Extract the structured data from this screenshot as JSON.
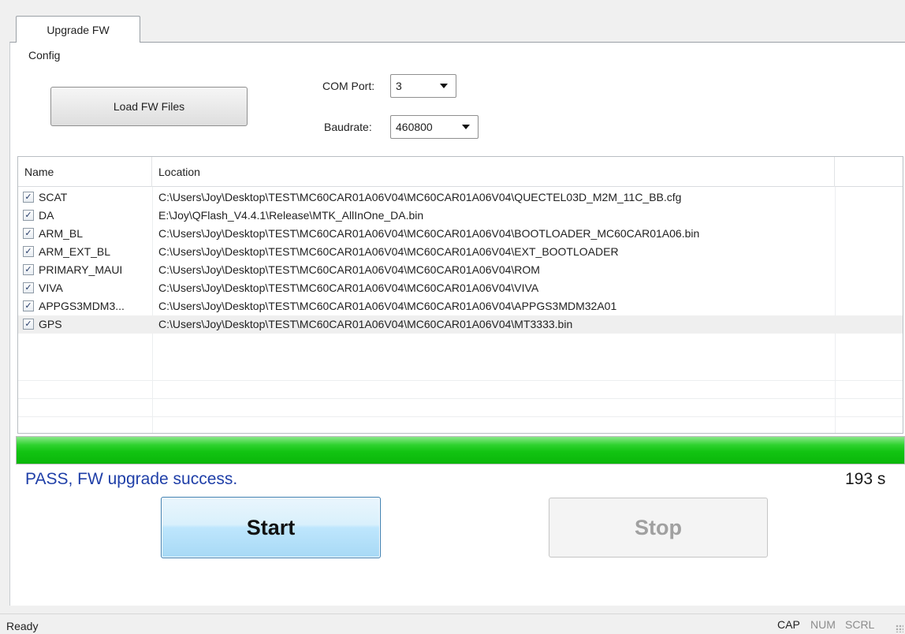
{
  "tab": {
    "label": "Upgrade FW"
  },
  "config": {
    "label": "Config",
    "load_button": "Load FW Files",
    "com_port": {
      "label": "COM Port:",
      "value": "3"
    },
    "baudrate": {
      "label": "Baudrate:",
      "value": "460800"
    }
  },
  "file_list": {
    "columns": [
      "Name",
      "Location"
    ],
    "rows": [
      {
        "name": "SCAT",
        "location": "C:\\Users\\Joy\\Desktop\\TEST\\MC60CAR01A06V04\\MC60CAR01A06V04\\QUECTEL03D_M2M_11C_BB.cfg",
        "checked": true
      },
      {
        "name": "DA",
        "location": "E:\\Joy\\QFlash_V4.4.1\\Release\\MTK_AllInOne_DA.bin",
        "checked": true
      },
      {
        "name": "ARM_BL",
        "location": "C:\\Users\\Joy\\Desktop\\TEST\\MC60CAR01A06V04\\MC60CAR01A06V04\\BOOTLOADER_MC60CAR01A06.bin",
        "checked": true
      },
      {
        "name": "ARM_EXT_BL",
        "location": "C:\\Users\\Joy\\Desktop\\TEST\\MC60CAR01A06V04\\MC60CAR01A06V04\\EXT_BOOTLOADER",
        "checked": true
      },
      {
        "name": "PRIMARY_MAUI",
        "location": "C:\\Users\\Joy\\Desktop\\TEST\\MC60CAR01A06V04\\MC60CAR01A06V04\\ROM",
        "checked": true
      },
      {
        "name": "VIVA",
        "location": "C:\\Users\\Joy\\Desktop\\TEST\\MC60CAR01A06V04\\MC60CAR01A06V04\\VIVA",
        "checked": true
      },
      {
        "name": "APPGS3MDM3...",
        "location": "C:\\Users\\Joy\\Desktop\\TEST\\MC60CAR01A06V04\\MC60CAR01A06V04\\APPGS3MDM32A01",
        "checked": true
      },
      {
        "name": "GPS",
        "location": "C:\\Users\\Joy\\Desktop\\TEST\\MC60CAR01A06V04\\MC60CAR01A06V04\\MT3333.bin",
        "checked": true
      }
    ],
    "selected_index": 7
  },
  "progress": {
    "fraction": 1.0,
    "color": "#12c412"
  },
  "status": {
    "message": "PASS, FW upgrade success.",
    "message_color": "#1f3fa8",
    "elapsed": "193 s"
  },
  "actions": {
    "start_label": "Start",
    "stop_label": "Stop",
    "stop_enabled": false
  },
  "statusbar": {
    "ready": "Ready",
    "indicators": [
      {
        "label": "CAP",
        "active": true
      },
      {
        "label": "NUM",
        "active": false
      },
      {
        "label": "SCRL",
        "active": false
      }
    ]
  }
}
